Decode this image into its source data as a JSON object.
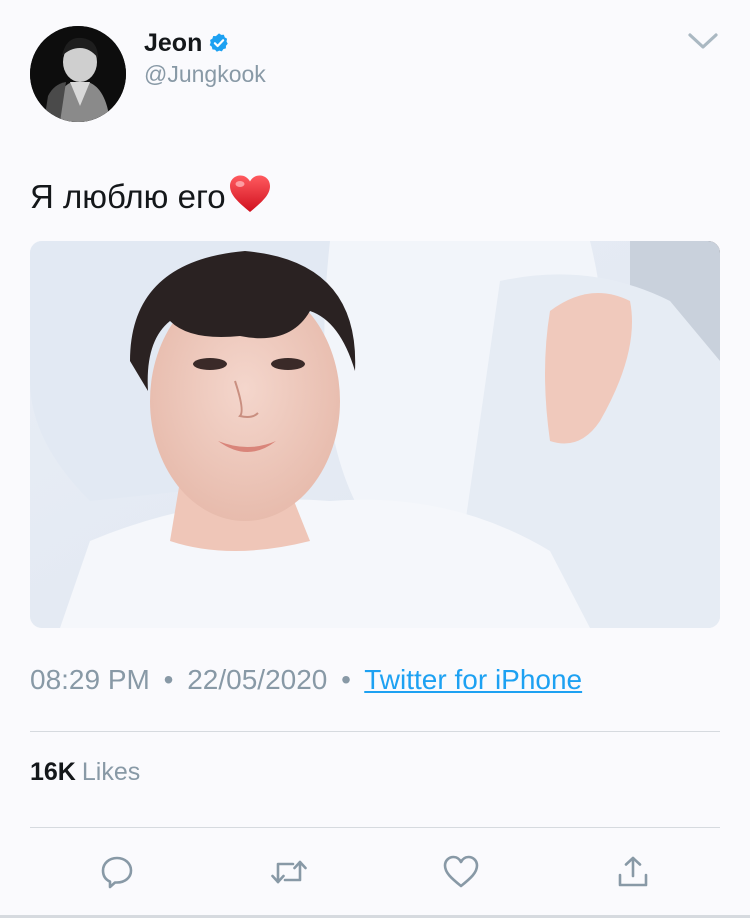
{
  "user": {
    "display_name": "Jeon",
    "handle": "@Jungkook",
    "verified": true,
    "avatar_icon": "profile-photo"
  },
  "tweet": {
    "text": "Я люблю его",
    "emoji": "❤️",
    "media_alt": "photo"
  },
  "meta": {
    "time": "08:29 PM",
    "separator": "•",
    "date": "22/05/2020",
    "source": "Twitter for iPhone"
  },
  "stats": {
    "likes_count": "16K",
    "likes_label": "Likes"
  },
  "actions": [
    {
      "name": "reply",
      "icon": "reply-icon"
    },
    {
      "name": "retweet",
      "icon": "retweet-icon"
    },
    {
      "name": "like",
      "icon": "heart-icon"
    },
    {
      "name": "share",
      "icon": "share-icon"
    }
  ],
  "colors": {
    "brand": "#1da1f2",
    "text": "#14171a",
    "secondary": "#8899a6",
    "heart": "#e0245e"
  }
}
